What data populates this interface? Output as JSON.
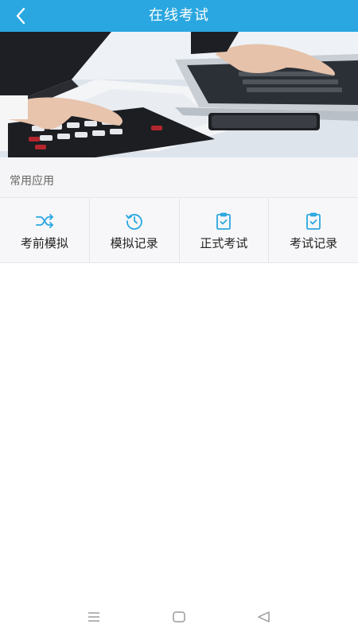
{
  "header": {
    "title": "在线考试",
    "back_icon": "chevron-left-icon"
  },
  "banner": {
    "description_icon": "office-photo",
    "colors": {
      "background": "#2aa7e0"
    }
  },
  "section": {
    "title": "常用应用"
  },
  "apps": [
    {
      "label": "考前模拟",
      "icon": "shuffle-icon"
    },
    {
      "label": "模拟记录",
      "icon": "history-icon"
    },
    {
      "label": "正式考试",
      "icon": "clipboard-check-icon"
    },
    {
      "label": "考试记录",
      "icon": "clipboard-check-icon"
    }
  ],
  "system_nav": {
    "menu_icon": "menu-icon",
    "home_icon": "home-icon",
    "back_icon": "back-triangle-icon"
  },
  "theme": {
    "accent": "#2aa7e0"
  }
}
